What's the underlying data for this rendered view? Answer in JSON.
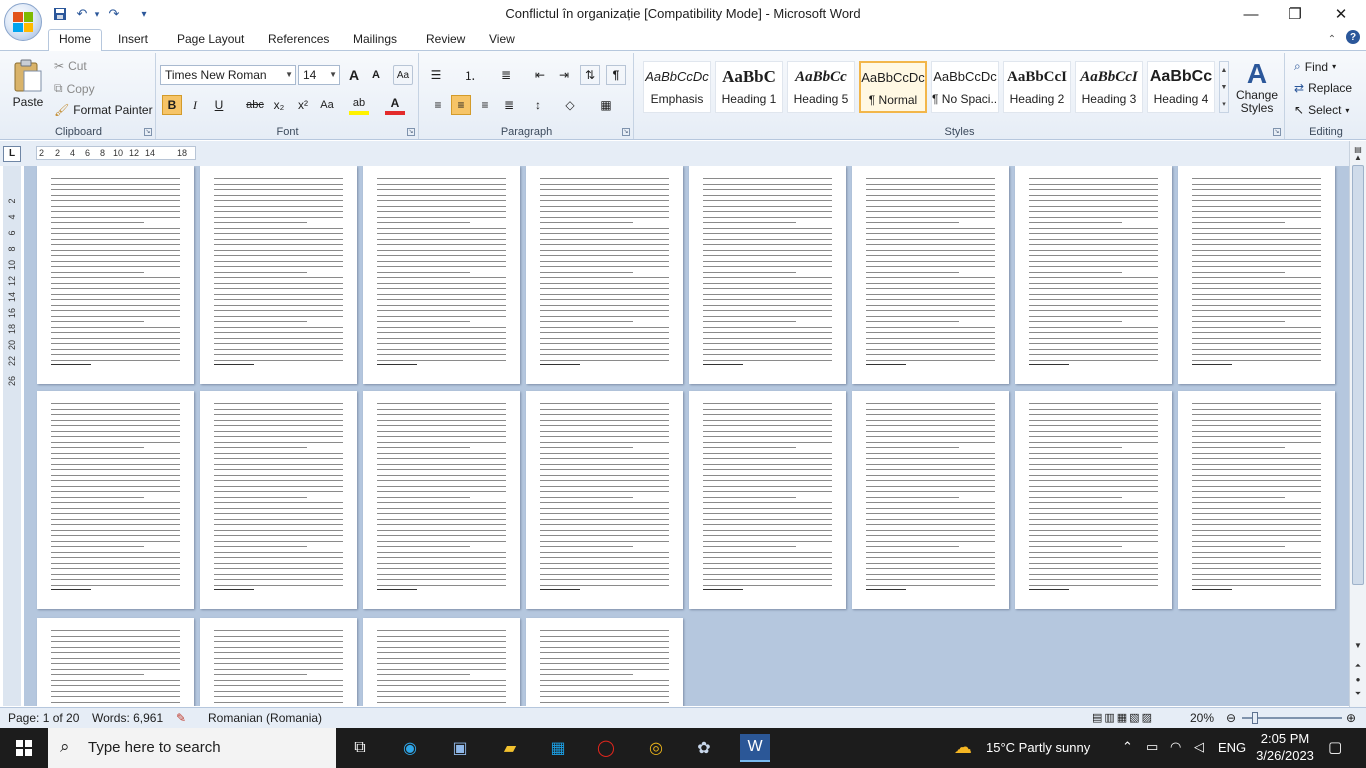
{
  "window": {
    "title": "Conflictul în organizație [Compatibility Mode] - Microsoft Word",
    "minimize": "—",
    "maximize": "❐",
    "close": "✕"
  },
  "qat": {
    "save_icon": "floppy-disk-icon",
    "undo": "↶",
    "redo": "↷",
    "customize": "▾"
  },
  "tabs": [
    "Home",
    "Insert",
    "Page Layout",
    "References",
    "Mailings",
    "Review",
    "View"
  ],
  "active_tab": "Home",
  "clipboard": {
    "label": "Clipboard",
    "paste": "Paste",
    "cut": "Cut",
    "copy": "Copy",
    "format_painter": "Format Painter"
  },
  "font": {
    "label": "Font",
    "family": "Times New Roman",
    "size": "14",
    "grow": "A",
    "shrink": "A",
    "clear": "Aa",
    "bold": "B",
    "italic": "I",
    "underline": "U",
    "strike": "abc",
    "subscript": "x₂",
    "superscript": "x²",
    "case": "Aa",
    "highlight": "ab",
    "color": "A"
  },
  "paragraph": {
    "label": "Paragraph"
  },
  "styles": {
    "label": "Styles",
    "items": [
      {
        "sample": "AaBbCcDc",
        "name": "Emphasis"
      },
      {
        "sample": "AaBbC",
        "name": "Heading 1"
      },
      {
        "sample": "AaBbCc",
        "name": "Heading 5"
      },
      {
        "sample": "AaBbCcDc",
        "name": "¶ Normal"
      },
      {
        "sample": "AaBbCcDc",
        "name": "¶ No Spaci..."
      },
      {
        "sample": "AaBbCcI",
        "name": "Heading 2"
      },
      {
        "sample": "AaBbCcI",
        "name": "Heading 3"
      },
      {
        "sample": "AaBbCc",
        "name": "Heading 4"
      }
    ],
    "selected": "¶ Normal",
    "change_styles": "Change Styles"
  },
  "editing": {
    "label": "Editing",
    "find": "Find",
    "replace": "Replace",
    "select": "Select"
  },
  "ruler": {
    "tab_selector": "L",
    "ticks": [
      "2",
      "2",
      "4",
      "6",
      "8",
      "10",
      "12",
      "14",
      "18"
    ],
    "vticks": [
      "2",
      "4",
      "6",
      "8",
      "10",
      "12",
      "14",
      "16",
      "18",
      "20",
      "22",
      "26"
    ]
  },
  "status": {
    "page": "Page: 1 of 20",
    "words": "Words: 6,961",
    "language": "Romanian (Romania)",
    "zoom": "20%"
  },
  "taskbar": {
    "search_placeholder": "Type here to search",
    "weather": "15°C  Partly sunny",
    "lang": "ENG",
    "time": "2:05 PM",
    "date": "3/26/2023"
  }
}
